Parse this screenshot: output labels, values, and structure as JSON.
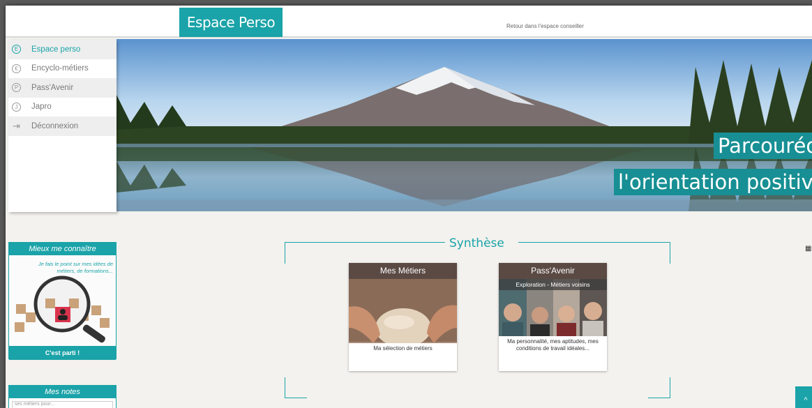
{
  "header": {
    "brand": "Espace Perso",
    "back_link": "Retour dans l'espace conseiller"
  },
  "sidebar": {
    "items": [
      {
        "label": "Espace perso",
        "icon": "E",
        "active": true
      },
      {
        "label": "Encyclo-métiers",
        "icon": "E",
        "active": false
      },
      {
        "label": "Pass'Avenir",
        "icon": "P",
        "active": false
      },
      {
        "label": "Japro",
        "icon": "J",
        "active": false
      },
      {
        "label": "Déconnexion",
        "icon": "logout-icon",
        "active": false
      }
    ]
  },
  "banner": {
    "line1": "Parcouréo",
    "line2": "l'orientation positive"
  },
  "widgets": {
    "know_me": {
      "title": "Mieux me connaître",
      "text": "Je fais le point sur mes idées de métiers, de formations...",
      "button": "C'est parti !"
    },
    "notes": {
      "title": "Mes notes",
      "input_placeholder": "ses métiers pour..."
    }
  },
  "synthese": {
    "title": "Synthèse",
    "cards": [
      {
        "title": "Mes Métiers",
        "caption": "Ma sélection de métiers"
      },
      {
        "title": "Pass'Avenir",
        "subtitle": "Exploration - Métiers voisins",
        "caption": "Ma personnalité, mes aptitudes, mes conditions de travail idéales..."
      }
    ]
  },
  "colors": {
    "accent": "#1aa3a8",
    "card_header": "#5b4a44",
    "page_bg": "#f3f2ee"
  }
}
